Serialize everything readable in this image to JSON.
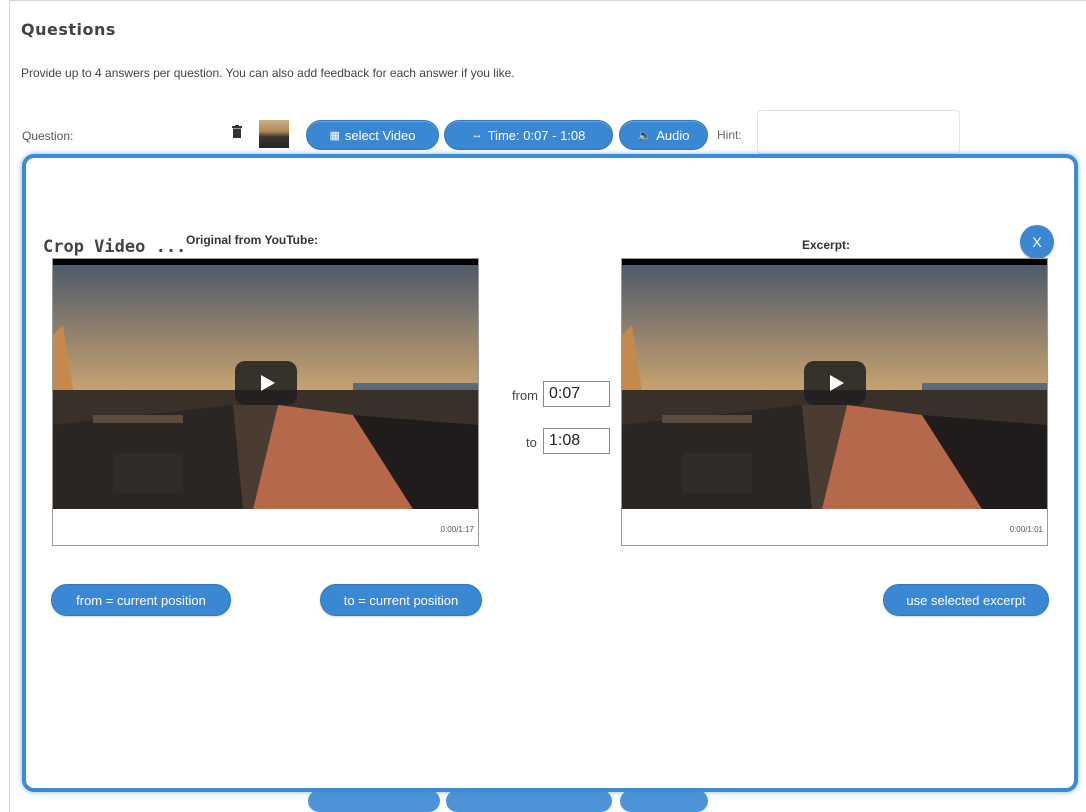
{
  "page": {
    "title": "Questions",
    "intro": "Provide up to 4 answers per question. You can also add feedback for each answer if you like."
  },
  "question_row": {
    "label": "Question:",
    "select_video_label": "select Video",
    "time_label": "Time: 0:07 - 1:08",
    "audio_label": "Audio",
    "hint_label": "Hint:"
  },
  "modal": {
    "title": "Crop Video ...",
    "original_label": "Original from YouTube:",
    "excerpt_label": "Excerpt:",
    "close_label": "X",
    "original_player": {
      "time": "0:00/1:17"
    },
    "excerpt_player": {
      "time": "0:00/1:01"
    },
    "from_label": "from",
    "from_value": "0:07",
    "to_label": "to",
    "to_value": "1:08",
    "from_current_button": "from = current position",
    "to_current_button": "to = current position",
    "use_excerpt_button": "use selected excerpt"
  },
  "colors": {
    "accent": "#3a87d3",
    "modal_border": "#3a8ad6"
  },
  "icons": [
    "trash-icon",
    "film-icon",
    "arrows-horizontal-icon",
    "speaker-icon",
    "play-icon",
    "close-icon"
  ]
}
